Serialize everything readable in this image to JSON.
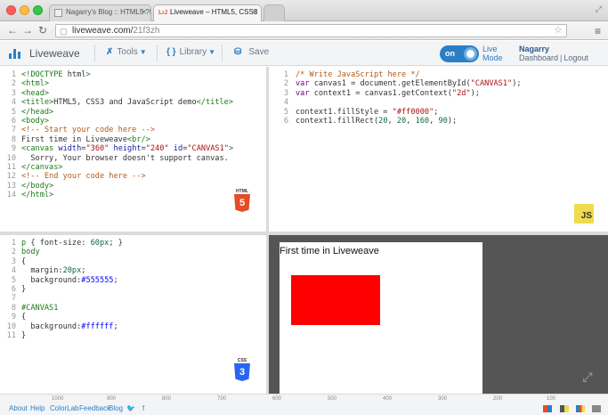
{
  "browser": {
    "tabs": [
      {
        "title": "Nagarry's Blog :: HTML5 ?l",
        "active": false
      },
      {
        "title": "Liveweave – HTML5, CSS3",
        "active": true
      }
    ],
    "url_prefix": "liveweave.com/",
    "url_path": "21f3zh"
  },
  "app": {
    "name": "Liveweave",
    "tools_label": "Tools",
    "library_label": "Library",
    "save_label": "Save",
    "toggle_label": "on",
    "live_line1": "Live",
    "live_line2": "Mode",
    "user_name": "Nagarry",
    "dashboard_label": "Dashboard",
    "logout_label": "Logout"
  },
  "html_lines": [
    "<!DOCTYPE html>",
    "<html>",
    "<head>",
    "<title>HTML5, CSS3 and JavaScript demo</title>",
    "</head>",
    "<body>",
    "<!-- Start your code here -->",
    "First time in Liveweave<br/>",
    "<canvas width=\"360\" height=\"240\" id=\"CANVAS1\">",
    "  Sorry, Your browser doesn't support canvas.",
    "</canvas>",
    "<!-- End your code here -->",
    "</body>",
    "</html>"
  ],
  "js_lines": [
    "/* Write JavaScript here */",
    "var canvas1 = document.getElementById(\"CANVAS1\");",
    "var context1 = canvas1.getContext(\"2d\");",
    "",
    "context1.fillStyle = \"#ff0000\";",
    "context1.fillRect(20, 20, 160, 90);"
  ],
  "css_lines": [
    "p { font-size: 60px; }",
    "body",
    "{",
    "  margin:20px;",
    "  background:#555555;",
    "}",
    "",
    "#CANVAS1",
    "{",
    "  background:#ffffff;",
    "}"
  ],
  "badges": {
    "html_label": "HTML",
    "html_num": "5",
    "css_label": "CSS",
    "css_num": "3",
    "js_label": "JS"
  },
  "preview": {
    "text": "First time in Liveweave",
    "background": "#555555",
    "canvas_background": "#ffffff",
    "fill_color": "#ff0000"
  },
  "ruler_ticks": [
    "1000",
    "900",
    "800",
    "700",
    "600",
    "500",
    "400",
    "300",
    "200",
    "100"
  ],
  "footer_links": [
    "About",
    "Help",
    "ColorLab",
    "Feedback",
    "Blog"
  ],
  "colors": {
    "accent": "#2a7fc6",
    "html_badge": "#e44d26",
    "css_badge": "#2965f1",
    "js_badge": "#f0db4f"
  }
}
